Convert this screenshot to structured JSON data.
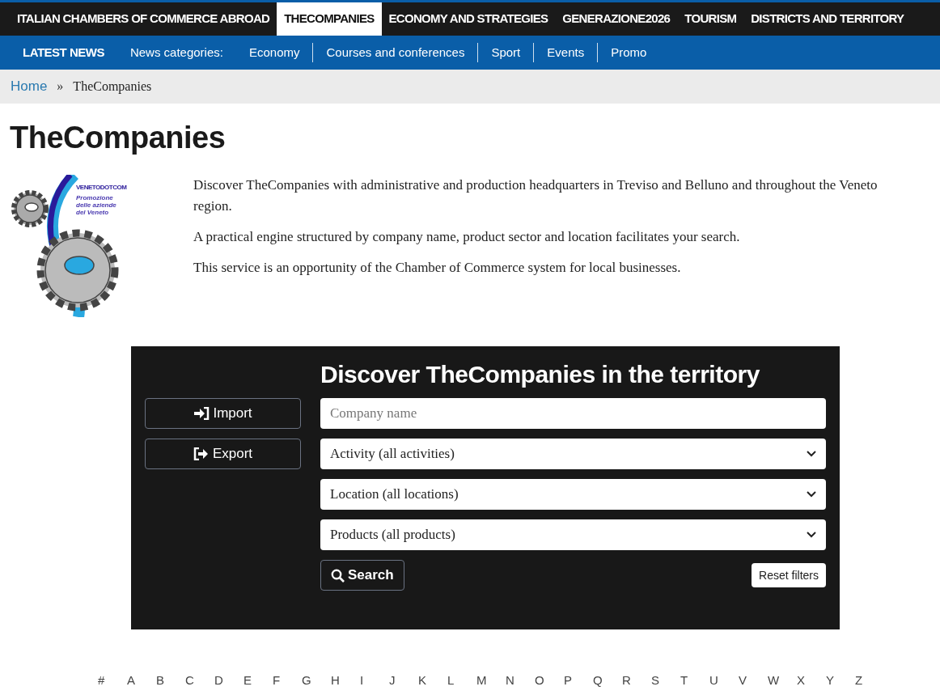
{
  "top_nav": [
    {
      "label": "ITALIAN CHAMBERS OF COMMERCE ABROAD",
      "selected": false
    },
    {
      "label": "THECOMPANIES",
      "selected": true
    },
    {
      "label": "ECONOMY AND STRATEGIES",
      "selected": false
    },
    {
      "label": "GENERAZIONE2026",
      "selected": false
    },
    {
      "label": "TOURISM",
      "selected": false
    },
    {
      "label": "DISTRICTS AND TERRITORY",
      "selected": false
    }
  ],
  "news_bar": {
    "title": "LATEST NEWS",
    "label": "News categories:",
    "categories": [
      "Economy",
      "Courses and conferences",
      "Sport",
      "Events",
      "Promo"
    ]
  },
  "breadcrumb": {
    "items": [
      "Home",
      "TheCompanies"
    ],
    "separator": "»"
  },
  "page_title": "TheCompanies",
  "logo": {
    "name": "VENETODOTCOM",
    "tagline": "Promozione delle aziende del Veneto"
  },
  "intro": [
    "Discover TheCompanies with administrative and production headquarters in Treviso and Belluno and throughout the Veneto region.",
    "A practical engine structured by company name, product sector and location facilitates your search.",
    "This service is an opportunity of the Chamber of Commerce system for local businesses."
  ],
  "search_panel": {
    "title": "Discover TheCompanies in the territory",
    "side_buttons": [
      {
        "label": "Import",
        "kind": "import"
      },
      {
        "label": "Export",
        "kind": "export"
      }
    ],
    "fields": [
      {
        "kind": "text",
        "placeholder": "Company name"
      },
      {
        "kind": "select",
        "value": "Activity (all activities)"
      },
      {
        "kind": "select",
        "value": "Location (all locations)"
      },
      {
        "kind": "select",
        "value": "Products (all products)"
      }
    ],
    "search_button": "Search",
    "reset_button": "Reset filters"
  },
  "alphabet": [
    "#",
    "A",
    "B",
    "C",
    "D",
    "E",
    "F",
    "G",
    "H",
    "I",
    "J",
    "K",
    "L",
    "M",
    "N",
    "O",
    "P",
    "Q",
    "R",
    "S",
    "T",
    "U",
    "V",
    "W",
    "X",
    "Y",
    "Z"
  ]
}
